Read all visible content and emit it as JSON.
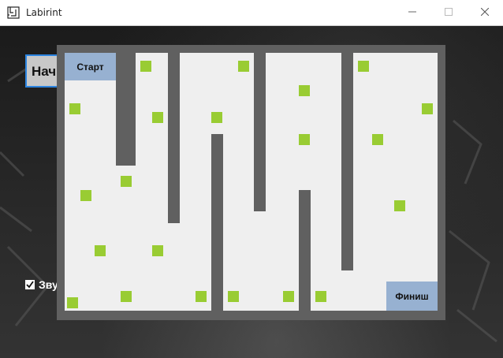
{
  "window": {
    "title": "Labirint",
    "icon": "maze-app-icon",
    "controls": [
      "minimize-icon",
      "maximize-icon",
      "close-icon"
    ]
  },
  "start_button": {
    "label": "Нач"
  },
  "sound": {
    "label": "Зву",
    "checked": true
  },
  "maze": {
    "start_label": "Старт",
    "finish_label": "Финиш",
    "colors": {
      "wall": "#606060",
      "floor": "#efefef",
      "coin": "#99cc33",
      "zone": "#97b1d1"
    }
  }
}
